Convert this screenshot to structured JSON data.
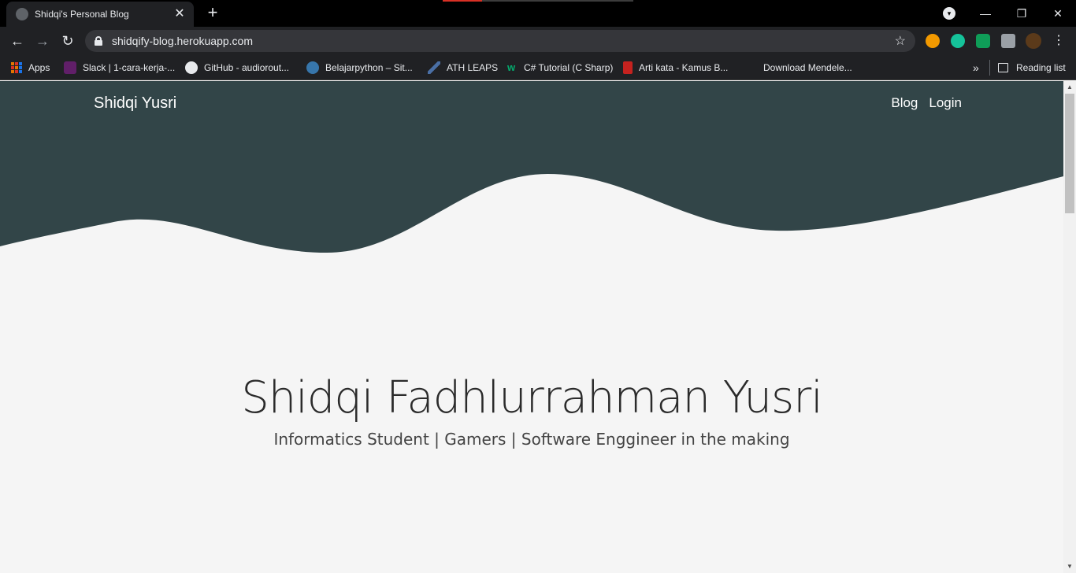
{
  "browser": {
    "tab_title": "Shidqi's Personal Blog",
    "tab_close_glyph": "✕",
    "new_tab_glyph": "+",
    "url": "shidqify-blog.herokuapp.com",
    "back_glyph": "←",
    "forward_glyph": "→",
    "reload_glyph": "↻",
    "star_glyph": "☆",
    "menu_glyph": "⋮",
    "tab_search_glyph": "▾",
    "minimize_glyph": "—",
    "restore_glyph": "❐",
    "close_glyph": "✕",
    "bookmarks": [
      {
        "label": "Apps",
        "icon": "apps-grid-icon"
      },
      {
        "label": "Slack | 1-cara-kerja-...",
        "icon": "slack-icon"
      },
      {
        "label": "GitHub - audiorout...",
        "icon": "github-icon"
      },
      {
        "label": "Belajarpython – Sit...",
        "icon": "python-icon"
      },
      {
        "label": "ATH LEAPS",
        "icon": "ath-icon"
      },
      {
        "label": "C# Tutorial (C Sharp)",
        "icon": "w3schools-icon"
      },
      {
        "label": "Arti kata - Kamus B...",
        "icon": "book-icon"
      },
      {
        "label": "Download Mendele...",
        "icon": "mendeley-icon"
      }
    ],
    "overflow_glyph": "»",
    "reading_list": "Reading list"
  },
  "site": {
    "brand": "Shidqi Yusri",
    "nav": [
      "Blog",
      "Login"
    ],
    "hero_title": "Shidqi Fadhlurrahman Yusri",
    "hero_subtitle": "Informatics Student | Gamers | Software Enggineer in the making"
  },
  "colors": {
    "header_bg": "#324548",
    "page_bg": "#f5f5f5",
    "chrome_dark": "#202124"
  }
}
